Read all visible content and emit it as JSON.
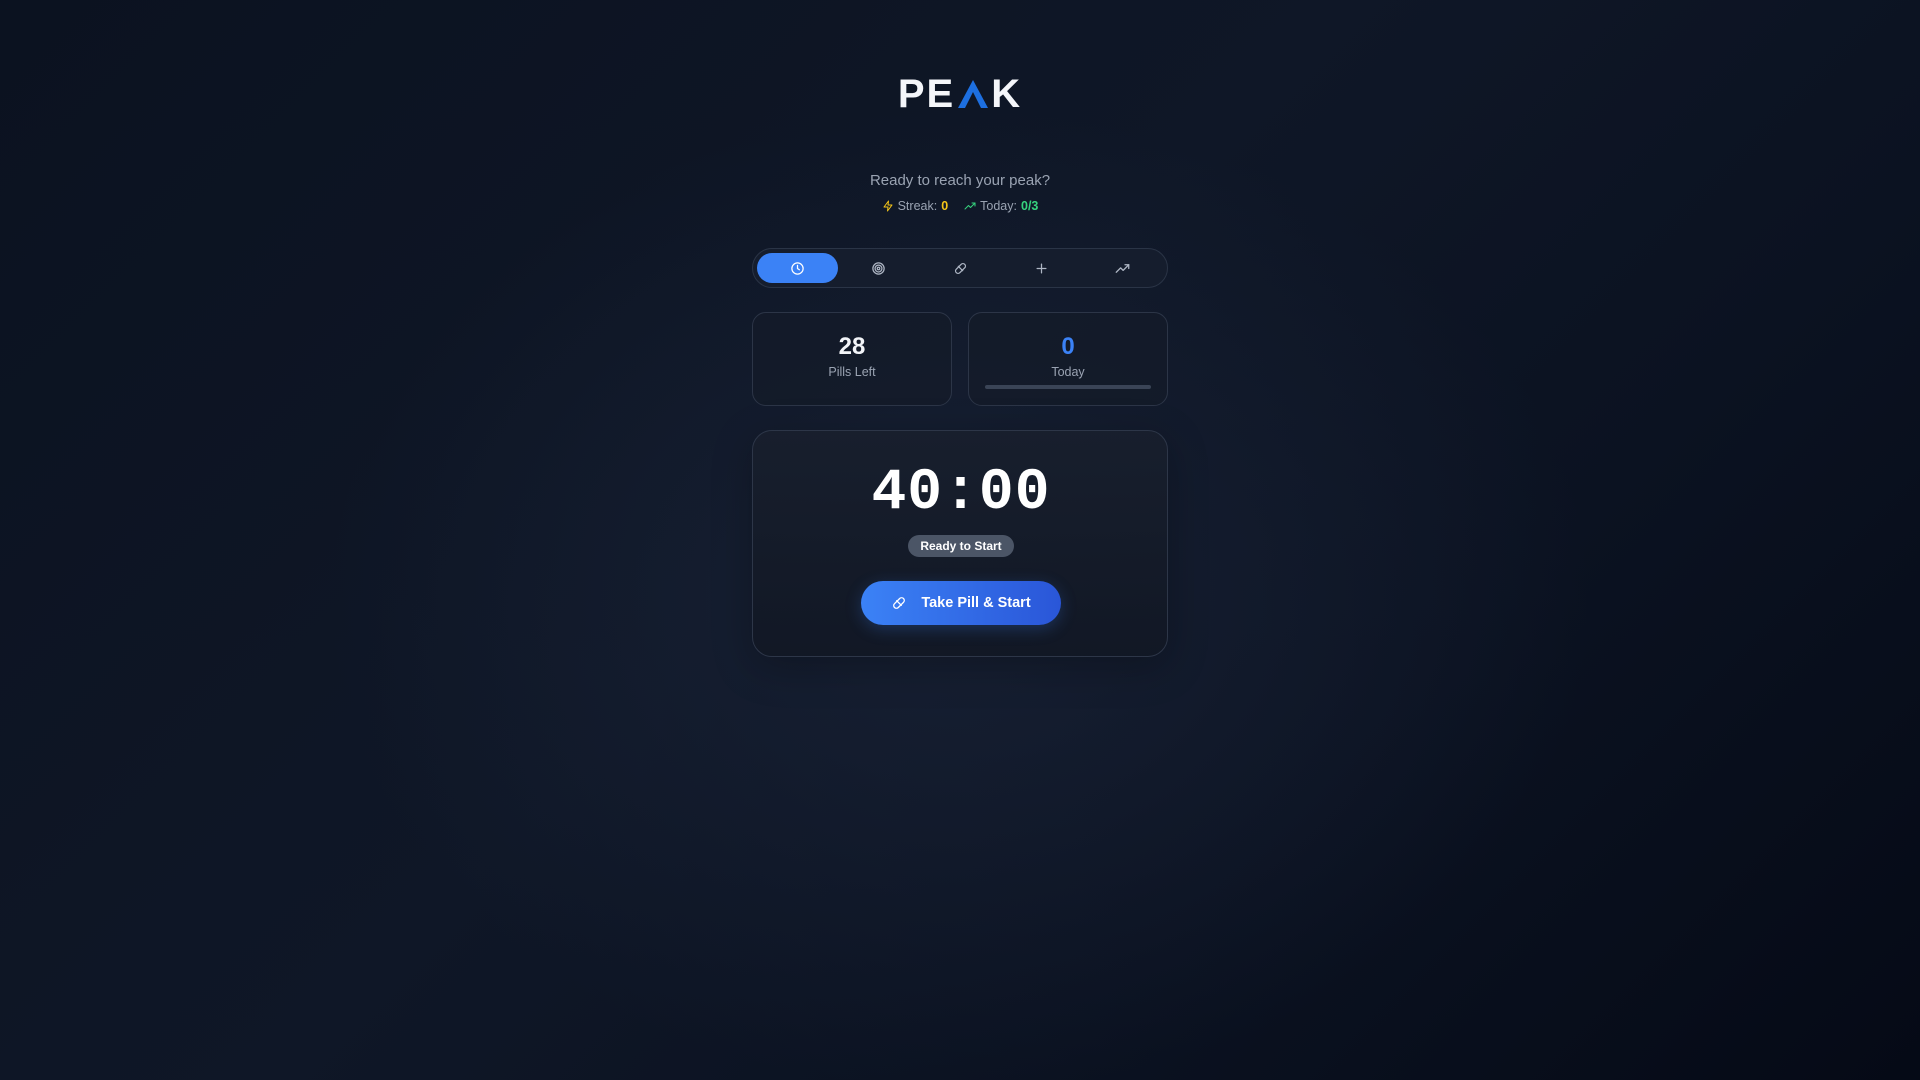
{
  "app": {
    "logo_text_left": "PE",
    "logo_text_right": "K",
    "tagline": "Ready to reach your peak?"
  },
  "header_stats": {
    "streak_label": "Streak:",
    "streak_value": "0",
    "today_label": "Today:",
    "today_value": "0/3"
  },
  "nav": {
    "items": [
      {
        "icon": "clock-icon",
        "active": true
      },
      {
        "icon": "target-icon",
        "active": false
      },
      {
        "icon": "pill-icon",
        "active": false
      },
      {
        "icon": "plus-icon",
        "active": false
      },
      {
        "icon": "trending-up-icon",
        "active": false
      }
    ]
  },
  "cards": {
    "pills_left_value": "28",
    "pills_left_label": "Pills Left",
    "today_value": "0",
    "today_label": "Today",
    "today_progress": 0
  },
  "timer": {
    "time": "40:00",
    "status": "Ready to Start",
    "button_label": "Take Pill & Start"
  },
  "colors": {
    "accent": "#3b82f6",
    "streak": "#f5c518",
    "today": "#36d37e",
    "background": "#0b1220"
  }
}
